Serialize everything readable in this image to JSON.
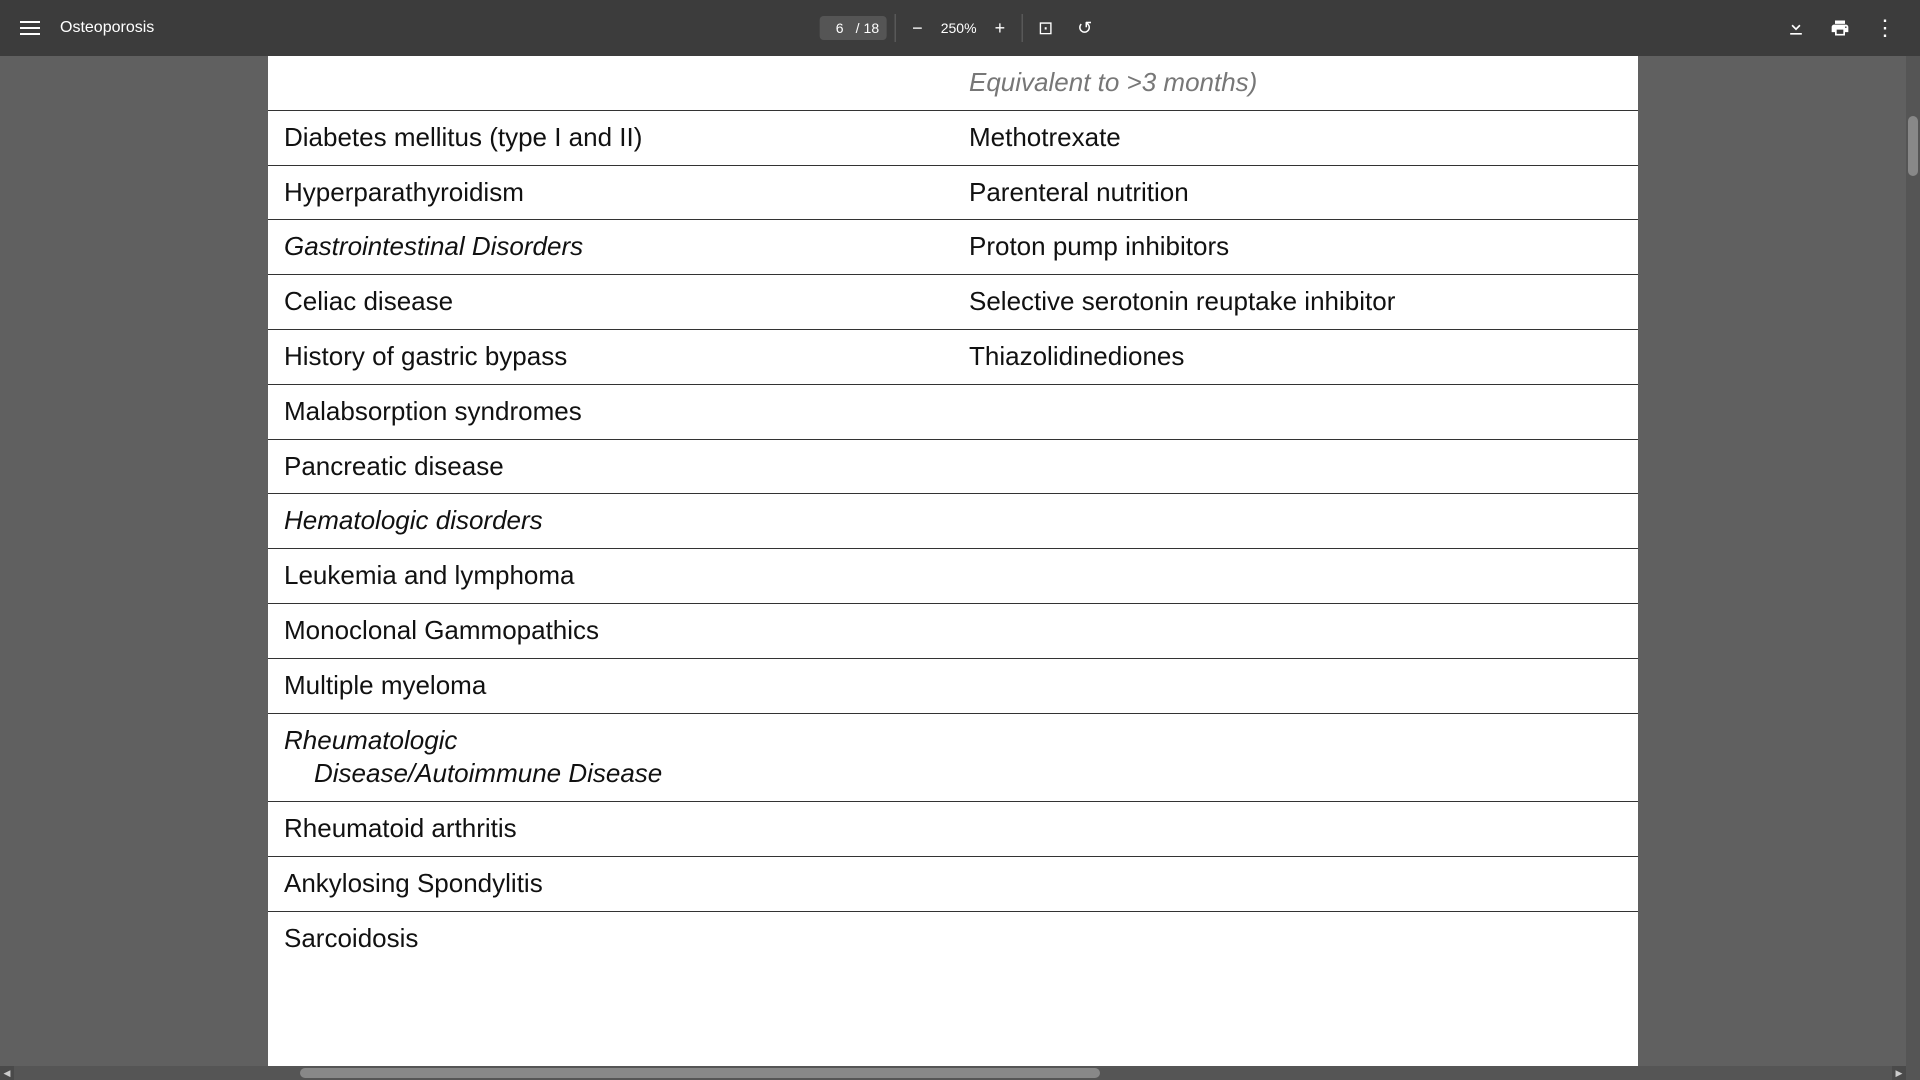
{
  "toolbar": {
    "menu_label": "Menu",
    "title": "Osteoporosis",
    "page_current": "6",
    "page_total": "18",
    "zoom": "250%",
    "zoom_out_label": "−",
    "zoom_in_label": "+",
    "fit_page_label": "⊡",
    "rotate_label": "↺",
    "download_label": "⬇",
    "print_label": "🖶",
    "more_label": "⋮"
  },
  "table": {
    "partial_top_right": "Equivalent to >3 months)",
    "rows": [
      {
        "left": "Diabetes mellitus (type I and II)",
        "right": "Methotrexate",
        "left_italic": false
      },
      {
        "left": "Hyperparathyroidism",
        "right": "Parenteral nutrition",
        "left_italic": false
      },
      {
        "left": "Gastrointestinal Disorders",
        "right": "Proton pump inhibitors",
        "left_italic": true
      },
      {
        "left": "Celiac disease",
        "right": "Selective serotonin reuptake inhibitor",
        "left_italic": false
      },
      {
        "left": "History of gastric bypass",
        "right": "Thiazolidinediones",
        "left_italic": false
      },
      {
        "left": "Malabsorption syndromes",
        "right": "",
        "left_italic": false
      },
      {
        "left": "Pancreatic disease",
        "right": "",
        "left_italic": false
      },
      {
        "left": "Hematologic disorders",
        "right": "",
        "left_italic": true
      },
      {
        "left": "Leukemia and lymphoma",
        "right": "",
        "left_italic": false
      },
      {
        "left": "Monoclonal Gammopathics",
        "right": "",
        "left_italic": false
      },
      {
        "left": "Multiple myeloma",
        "right": "",
        "left_italic": false
      },
      {
        "left_line1": "Rheumatologic",
        "left_line2": "Disease/Autoimmune Disease",
        "left_line2_indent": true,
        "right": "",
        "left_italic": true,
        "multiline": true
      },
      {
        "left": "Rheumatoid arthritis",
        "right": "",
        "left_italic": false
      },
      {
        "left": "Ankylosing Spondylitis",
        "right": "",
        "left_italic": false
      },
      {
        "left": "Sarcoidosis",
        "right": "",
        "left_italic": false,
        "no_bottom_border": true
      }
    ]
  }
}
